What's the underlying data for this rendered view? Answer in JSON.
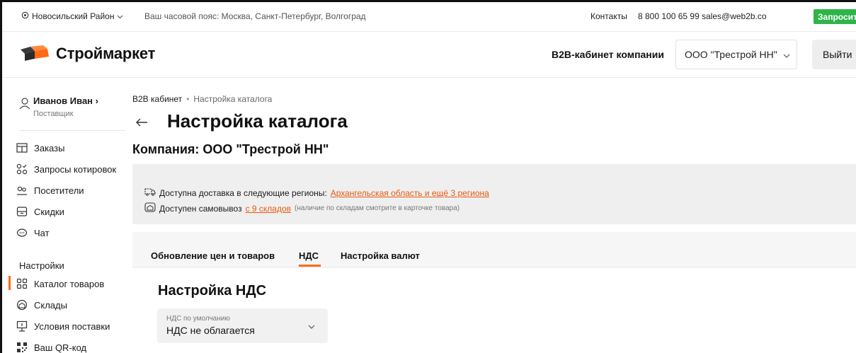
{
  "topbar": {
    "region": "Новосильский Район",
    "timezone": "Ваш часовой пояс: Москва, Санкт-Петербург, Волгоград",
    "contacts": "Контакты",
    "phone": "8 800 100 65 99",
    "email": "sales@web2b.co",
    "request_kp": "Запросить КП"
  },
  "header": {
    "logo_text": "Строймаркет",
    "b2b_label": "B2B-кабинет компании",
    "company_selected": "ООО \"Трестрой НН\"",
    "logout": "Выйти"
  },
  "user": {
    "name": "Иванов Иван",
    "name_arrow": "›",
    "role": "Поставщик"
  },
  "sidebar": {
    "items": [
      {
        "label": "Заказы",
        "icon": "orders-icon"
      },
      {
        "label": "Запросы котировок",
        "icon": "quotes-icon"
      },
      {
        "label": "Посетители",
        "icon": "visitors-icon"
      },
      {
        "label": "Скидки",
        "icon": "discounts-icon"
      },
      {
        "label": "Чат",
        "icon": "chat-icon"
      }
    ],
    "settings_section": "Настройки",
    "settings_items": [
      {
        "label": "Каталог товаров",
        "icon": "catalog-icon",
        "active": true
      },
      {
        "label": "Склады",
        "icon": "warehouse-icon"
      },
      {
        "label": "Условия поставки",
        "icon": "delivery-terms-icon"
      },
      {
        "label": "Ваш QR-код",
        "icon": "qr-code-icon"
      }
    ]
  },
  "breadcrumb": {
    "root": "B2B кабинет",
    "separator": "•",
    "current": "Настройка каталога"
  },
  "page": {
    "title": "Настройка каталога",
    "company": "Компания: ООО \"Трестрой НН\""
  },
  "delivery_info": {
    "delivery_text": "Доступна доставка в следующие регионы:",
    "delivery_link": "Архангельская область и ещё 3 региона",
    "pickup_text": "Доступен самовывоз",
    "pickup_link": "с 9 складов",
    "pickup_note": "(наличие по складам смотрите в карточке товара)"
  },
  "tabs": [
    {
      "label": "Обновление цен и товаров",
      "active": false
    },
    {
      "label": "НДС",
      "active": true
    },
    {
      "label": "Настройка валют",
      "active": false
    }
  ],
  "nds": {
    "title": "Настройка НДС",
    "select_label": "НДС по умолчанию",
    "select_value": "НДС не облагается"
  },
  "colors": {
    "accent": "#ff6a13",
    "link": "#e85a10",
    "green_button": "#2fb44a",
    "panel_bg": "#efefef"
  }
}
